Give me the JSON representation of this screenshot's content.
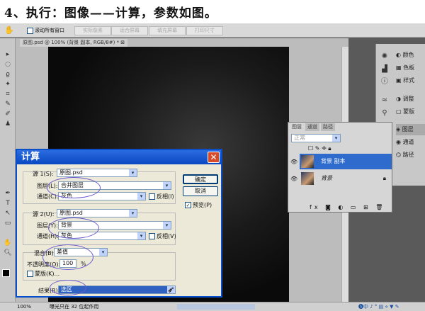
{
  "heading": "4、执行：图像——计算，参数如图。",
  "options_bar": {
    "checkbox_label": "滚动所有窗口",
    "buttons": [
      "实际像素",
      "适合屏幕",
      "填充屏幕",
      "打印尺寸"
    ]
  },
  "document_tab": "原图.psd @ 100% (背景 副本, RGB/8#) * ⊠",
  "dock": {
    "items": [
      {
        "label": "颜色",
        "icon": "color-icon"
      },
      {
        "label": "色板",
        "icon": "swatches-icon"
      },
      {
        "label": "样式",
        "icon": "styles-icon"
      },
      {
        "label": "调整",
        "icon": "adjustments-icon"
      },
      {
        "label": "蒙版",
        "icon": "masks-icon"
      },
      {
        "label": "图层",
        "icon": "layers-icon"
      },
      {
        "label": "通道",
        "icon": "channels-icon"
      },
      {
        "label": "路径",
        "icon": "paths-icon"
      }
    ]
  },
  "layers_panel": {
    "tabs": [
      "图层",
      "通道",
      "路径"
    ],
    "blend_mode": "正常",
    "layers": [
      {
        "name": "背景 副本",
        "selected": true
      },
      {
        "name": "背景",
        "locked": true
      }
    ]
  },
  "dialog": {
    "title": "计算",
    "source1": {
      "label": "源 1(S):",
      "file": "原图.psd",
      "layer_label": "图层(L):",
      "layer": "合并图层",
      "channel_label": "通道(C):",
      "channel": "灰色",
      "invert_label": "反相(I)"
    },
    "source2": {
      "label": "源 2(U):",
      "file": "原图.psd",
      "layer_label": "图层(Y):",
      "layer": "背景",
      "channel_label": "通道(H):",
      "channel": "灰色",
      "invert_label": "反相(V)"
    },
    "blending": {
      "label": "混合(B):",
      "mode": "差值",
      "opacity_label": "不透明度(O):",
      "opacity": "100",
      "unit": "%",
      "mask_label": "蒙版(K)..."
    },
    "result": {
      "label": "结果(R):",
      "value": "选区"
    },
    "ok": "确定",
    "cancel": "取消",
    "preview_label": "预览(P)",
    "preview_checked": true,
    "accent": "#0a48c2"
  },
  "status": {
    "zoom": "100%",
    "message": "曝光只在 32 位起作用"
  }
}
